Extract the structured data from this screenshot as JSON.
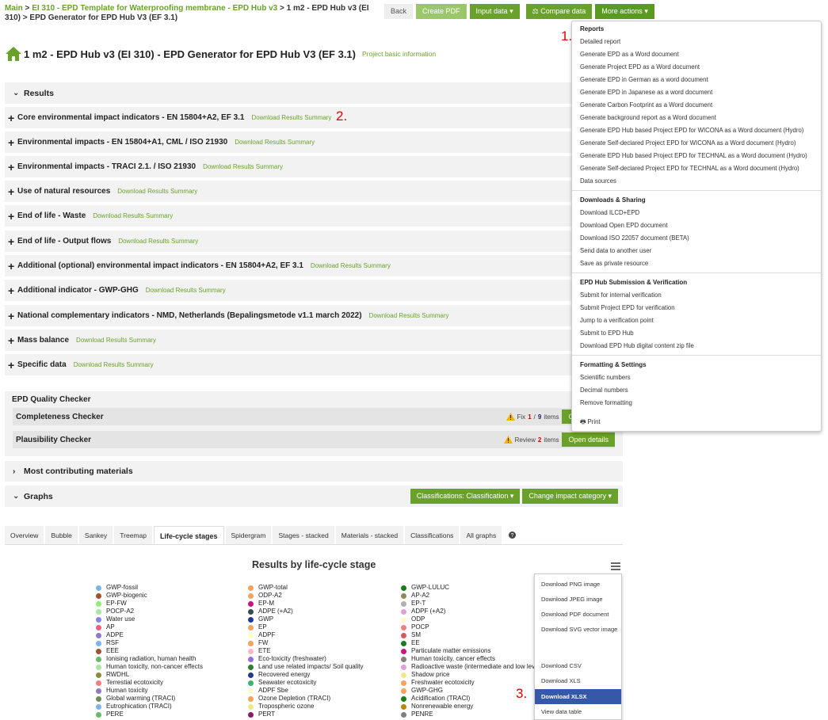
{
  "breadcrumb": {
    "main": "Main",
    "sep1": " > ",
    "template": "EI 310 - EPD Template for Waterproofing membrane - EPD Hub v3",
    "sep2": " > ",
    "current": "1 m2 - EPD Hub v3 (EI 310) > EPD Generator for EPD Hub V3 (EF 3.1)"
  },
  "toolbar": {
    "back": "Back",
    "create_pdf": "Create PDF",
    "input_data": "Input data",
    "compare": "Compare data",
    "more": "More actions"
  },
  "page": {
    "title": "1 m2 - EPD Hub v3 (EI 310) - EPD Generator for EPD Hub V3 (EF 3.1)",
    "project_info": "Project basic information"
  },
  "results": {
    "header": "Results",
    "download_label": "Download Results Summary",
    "sections": [
      "Core environmental impact indicators - EN 15804+A2, EF 3.1",
      "Environmental impacts - EN 15804+A1, CML / ISO 21930",
      "Environmental impacts - TRACI 2.1. / ISO 21930",
      "Use of natural resources",
      "End of life - Waste",
      "End of life - Output flows",
      "Additional (optional) environmental impact indicators - EN 15804+A2, EF 3.1",
      "Additional indicator - GWP-GHG",
      "National complementary indicators - NMD, Netherlands (Bepalingsmetode v1.1 march 2022)",
      "Mass balance",
      "Specific data"
    ]
  },
  "quality": {
    "title": "EPD Quality Checker",
    "completeness": {
      "label": "Completeness Checker",
      "prefix": "Fix",
      "count": "1",
      "slash": "/",
      "total": "9",
      "suffix": "items",
      "button": "Open details"
    },
    "plausibility": {
      "label": "Plausibility Checker",
      "prefix": "Review",
      "count": "2",
      "suffix": "items",
      "button": "Open details"
    }
  },
  "most_contributing": "Most contributing materials",
  "graphs": {
    "header": "Graphs",
    "classifications_btn": "Classifications: Classification",
    "impact_btn": "Change impact category",
    "tabs": [
      "Overview",
      "Bubble",
      "Sankey",
      "Treemap",
      "Life-cycle stages",
      "Spidergram",
      "Stages - stacked",
      "Materials - stacked",
      "Classifications",
      "All graphs"
    ],
    "active_tab": "Life-cycle stages"
  },
  "chart_data": {
    "type": "bar",
    "title": "Results by life-cycle stage",
    "legend_columns": [
      [
        {
          "name": "GWP-fossil",
          "color": "#7cb5ec"
        },
        {
          "name": "GWP-biogenic",
          "color": "#a0522d"
        },
        {
          "name": "EP-FW",
          "color": "#90ed7d"
        },
        {
          "name": "POCP-A2",
          "color": "#a8e6a3"
        },
        {
          "name": "Water use",
          "color": "#8085e9"
        },
        {
          "name": "AP",
          "color": "#f15c80"
        },
        {
          "name": "ADPE",
          "color": "#8e7cc3"
        },
        {
          "name": "RSF",
          "color": "#7cb5ec"
        },
        {
          "name": "EEE",
          "color": "#a0522d"
        },
        {
          "name": "Ionising radiation, human health",
          "color": "#66bb6a"
        },
        {
          "name": "Human toxicity, non-cancer effects",
          "color": "#a8e6a3"
        },
        {
          "name": "RWDHL",
          "color": "#8b8b3a"
        },
        {
          "name": "Terrestial ecotoxicity",
          "color": "#f08080"
        },
        {
          "name": "Human toxicity",
          "color": "#8e7cc3"
        },
        {
          "name": "Global warming (TRACI)",
          "color": "#6a8f5a"
        },
        {
          "name": "Eutrophication (TRACI)",
          "color": "#7cb5ec"
        },
        {
          "name": "PERE",
          "color": "#66bb6a"
        }
      ],
      [
        {
          "name": "GWP-total",
          "color": "#f7a35c"
        },
        {
          "name": "ODP-A2",
          "color": "#f4a460"
        },
        {
          "name": "EP-M",
          "color": "#c71585"
        },
        {
          "name": "ADPE (+A2)",
          "color": "#2f4f4f"
        },
        {
          "name": "GWP",
          "color": "#1f3a93"
        },
        {
          "name": "EP",
          "color": "#f7a35c"
        },
        {
          "name": "ADPF",
          "color": "#fffacd"
        },
        {
          "name": "FW",
          "color": "#f7a35c"
        },
        {
          "name": "ETE",
          "color": "#ffb6c1"
        },
        {
          "name": "Eco-toxicity (freshwater)",
          "color": "#9370db"
        },
        {
          "name": "Land use related impacts/ Soil quality",
          "color": "#2e7d32"
        },
        {
          "name": "Recovered energy",
          "color": "#1f3a93"
        },
        {
          "name": "Seawater ecotoxicity",
          "color": "#3cb371"
        },
        {
          "name": "ADPF Sbe",
          "color": "#fffacd"
        },
        {
          "name": "Ozone Depletion (TRACI)",
          "color": "#f7a35c"
        },
        {
          "name": "Tropospheric ozone",
          "color": "#f0e68c"
        },
        {
          "name": "PERT",
          "color": "#8b1a6b"
        }
      ],
      [
        {
          "name": "GWP-LULUC",
          "color": "#1b7a1b"
        },
        {
          "name": "AP-A2",
          "color": "#8b8b5a"
        },
        {
          "name": "EP-T",
          "color": "#b0b0b0"
        },
        {
          "name": "ADPF (+A2)",
          "color": "#dda0dd"
        },
        {
          "name": "ODP",
          "color": "#fffacd"
        },
        {
          "name": "POCP",
          "color": "#f08080"
        },
        {
          "name": "SM",
          "color": "#cd5c5c"
        },
        {
          "name": "EE",
          "color": "#1b7a1b"
        },
        {
          "name": "Particulate matter emissions",
          "color": "#c71585"
        },
        {
          "name": "Human toxicity, cancer effects",
          "color": "#808080"
        },
        {
          "name": "Radioactive waste (intermediate and low lev",
          "color": "#dda0dd"
        },
        {
          "name": "Shadow price",
          "color": "#f0e68c"
        },
        {
          "name": "Freshwater ecotoxicity",
          "color": "#f4a460"
        },
        {
          "name": "GWP-GHG",
          "color": "#f7a35c"
        },
        {
          "name": "Acidification (TRACI)",
          "color": "#1b7a1b"
        },
        {
          "name": "Nonrenewable energy",
          "color": "#b8860b"
        },
        {
          "name": "PENRE",
          "color": "#808080"
        }
      ]
    ]
  },
  "more_actions_menu": {
    "sections": [
      {
        "title": "Reports",
        "items": [
          "Detailed report",
          "Generate EPD as a Word document",
          "Generate Project EPD as a Word document",
          "Generate EPD in German as a word document",
          "Generate EPD in Japanese as a word document",
          "Generate Carbon Footprint as a Word document",
          "Generate background report as a Word document",
          "Generate EPD Hub based Project EPD for WICONA as a Word document (Hydro)",
          "Generate Self-declared Project EPD for WICONA as a Word document (Hydro)",
          "Generate EPD Hub based Project EPD for TECHNAL as a Word document (Hydro)",
          "Generate Self-declared Project EPD for TECHNAL as a Word document (Hydro)",
          "Data sources"
        ]
      },
      {
        "title": "Downloads & Sharing",
        "items": [
          "Download ILCD+EPD",
          "Download Open EPD document",
          "Download ISO 22057 document (BETA)",
          "Send data to another user",
          "Save as private resource"
        ]
      },
      {
        "title": "EPD Hub Submission & Verification",
        "items": [
          "Submit for internal verification",
          "Submit Project EPD for verification",
          "Jump to a verification point",
          "Submit to EPD Hub",
          "Download EPD Hub digital content zip file"
        ]
      },
      {
        "title": "Formatting & Settings",
        "items": [
          "Scientific numbers",
          "Decimal numbers",
          "Remove formatting"
        ]
      }
    ],
    "print": "Print"
  },
  "export_menu": {
    "items": [
      "Download PNG image",
      "Download JPEG image",
      "Download PDF document",
      "Download SVG vector image",
      "Download CSV",
      "Download XLS",
      "Download XLSX",
      "View data table"
    ],
    "highlighted": "Download XLSX"
  },
  "markers": [
    "1.",
    "2.",
    "3."
  ],
  "colors": {
    "accent": "#6aa12a",
    "highlight": "#3558a8",
    "marker": "#dd0000"
  }
}
